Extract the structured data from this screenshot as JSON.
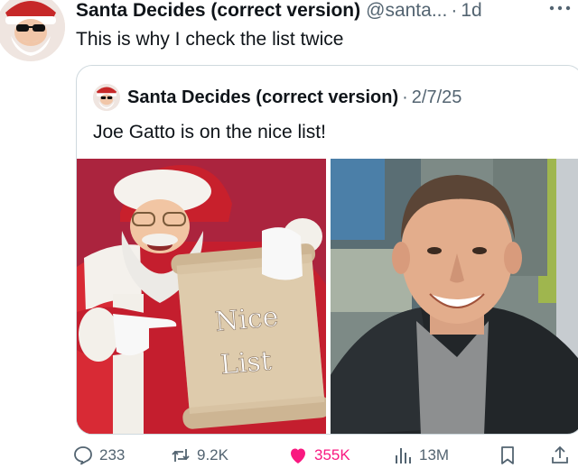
{
  "tweet": {
    "author_name": "Santa Decides (correct version)",
    "handle": "@santa...",
    "separator": "·",
    "time": "1d",
    "text": "This is why I check the list twice"
  },
  "quote": {
    "author_name": "Santa Decides (correct version)",
    "separator": "·",
    "date": "2/7/25",
    "text": "Joe Gatto is on the nice list!",
    "scroll_text_line1": "Nice",
    "scroll_text_line2": "List"
  },
  "actions": {
    "replies": "233",
    "reposts": "9.2K",
    "likes": "355K",
    "views": "13M"
  },
  "colors": {
    "like_active": "#f91880",
    "muted": "#536471",
    "border": "#cfd9de"
  },
  "icons": [
    "more-icon",
    "reply-icon",
    "repost-icon",
    "heart-icon",
    "views-icon",
    "bookmark-icon",
    "share-icon"
  ]
}
